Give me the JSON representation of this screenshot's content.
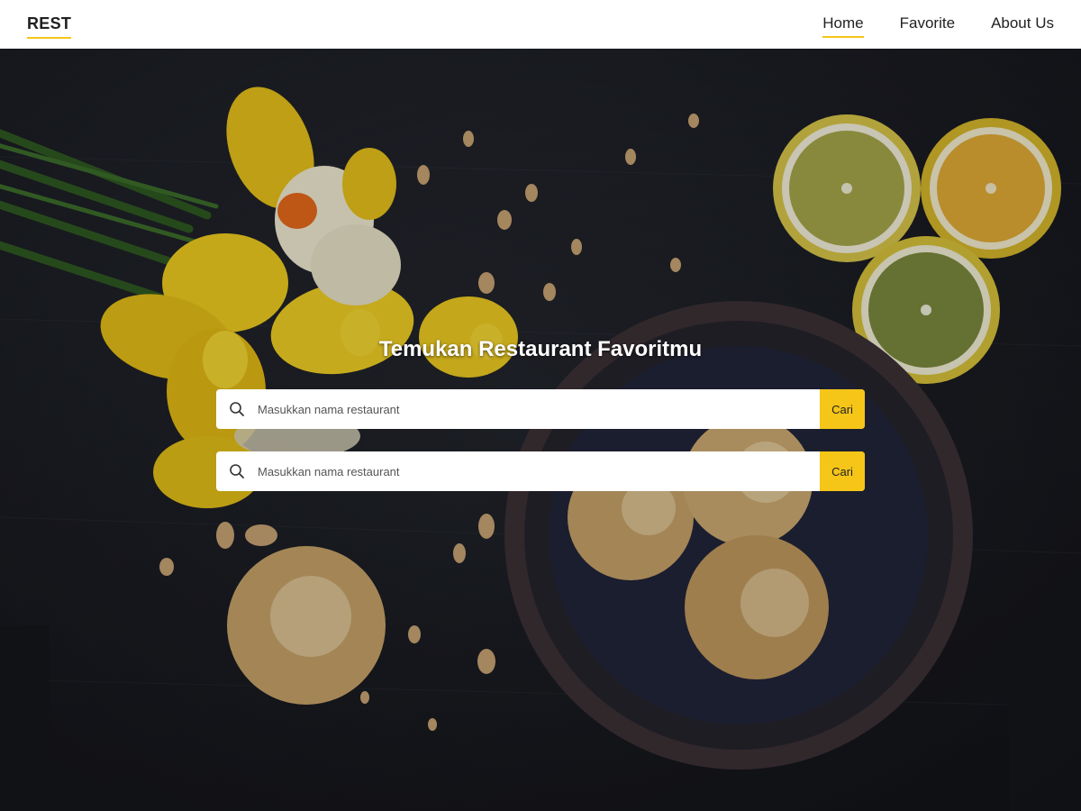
{
  "navbar": {
    "brand": "REST",
    "links": [
      {
        "label": "Home",
        "active": true
      },
      {
        "label": "Favorite",
        "active": false
      },
      {
        "label": "About Us",
        "active": false
      }
    ]
  },
  "hero": {
    "title": "Temukan Restaurant Favoritmu",
    "searches": [
      {
        "placeholder": "Masukkan nama restaurant",
        "button_label": "Cari",
        "icon": "search-icon"
      },
      {
        "placeholder": "Masukkan nama restaurant",
        "button_label": "Cari",
        "icon": "search-icon"
      }
    ]
  },
  "colors": {
    "accent": "#f5c518",
    "navbar_bg": "#ffffff",
    "hero_bg": "#23262d",
    "text_dark": "#222222"
  }
}
